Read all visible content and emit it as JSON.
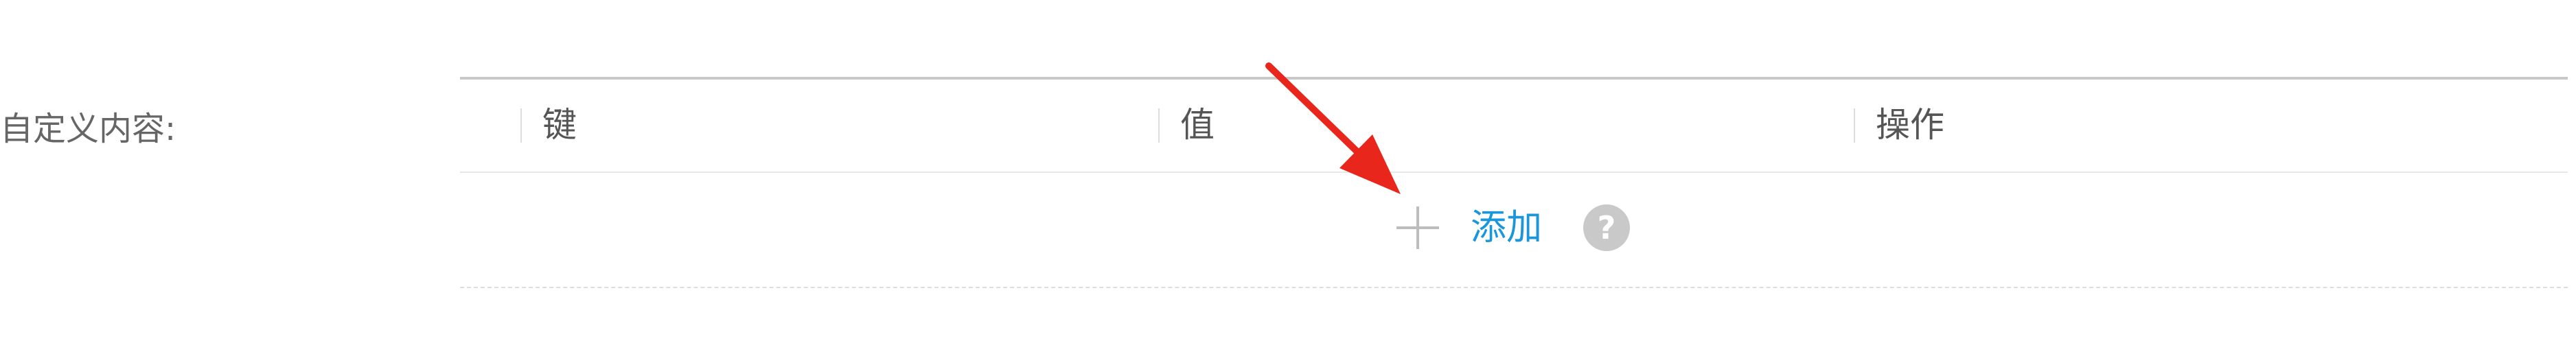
{
  "form": {
    "label": "自定义内容:"
  },
  "table": {
    "columns": [
      "键",
      "值",
      "操作"
    ]
  },
  "add_row": {
    "add_label": "添加",
    "plus_icon": "plus-icon",
    "help_icon": "help-icon",
    "help_glyph": "?"
  },
  "annotation": {
    "arrow_icon": "red-arrow",
    "arrow_color": "#e8261c"
  },
  "colors": {
    "accent": "#1a96db",
    "label_text": "#666666",
    "header_text": "#555555",
    "border": "#c8c8c8",
    "icon_gray": "#c9c9c9"
  }
}
